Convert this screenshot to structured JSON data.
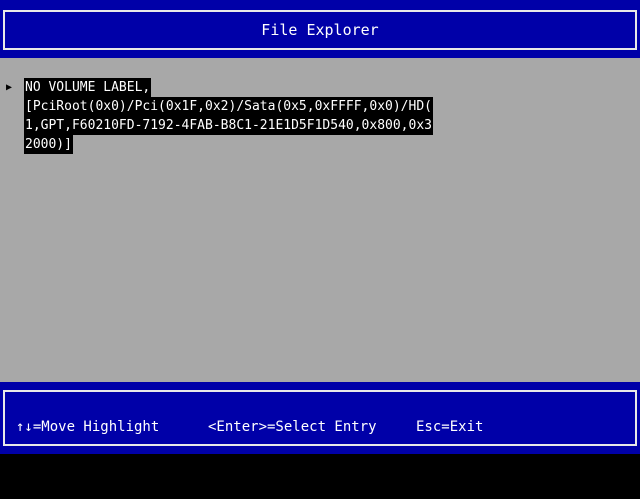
{
  "header": {
    "title": "File Explorer"
  },
  "entries": [
    {
      "pointer_icon": "right-triangle-pointer",
      "lines": [
        "NO VOLUME LABEL,",
        "[PciRoot(0x0)/Pci(0x1F,0x2)/Sata(0x5,0xFFFF,0x0)/HD(",
        "1,GPT,F60210FD-7192-4FAB-B8C1-21E1D5F1D540,0x800,0x3",
        "2000)]"
      ]
    }
  ],
  "footer": {
    "move_highlight": "↑↓=Move Highlight",
    "select_entry": "<Enter>=Select Entry",
    "exit": "Esc=Exit"
  },
  "colors": {
    "header_bg": "#0000a8",
    "main_bg": "#a8a8a8",
    "highlight_bg": "#000000",
    "text": "#ffffff"
  }
}
